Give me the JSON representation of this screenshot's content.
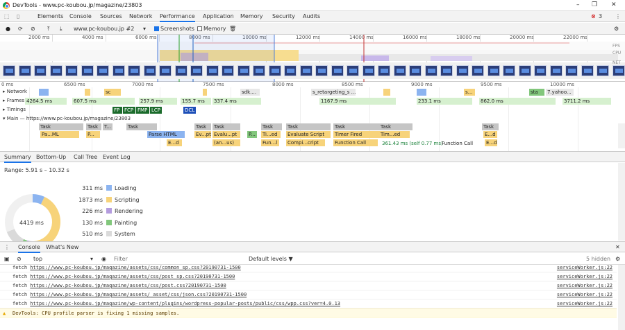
{
  "window": {
    "title": "DevTools - www.pc-koubou.jp/magazine/23803"
  },
  "tabs": [
    "Elements",
    "Console",
    "Sources",
    "Network",
    "Performance",
    "Application",
    "Memory",
    "Security",
    "Audits"
  ],
  "active_tab": "Performance",
  "error_count": "3",
  "toolbar": {
    "recording_select": "www.pc-koubou.jp #2",
    "screenshots_label": "Screenshots",
    "memory_label": "Memory"
  },
  "overview": {
    "ruler": [
      "2000 ms",
      "4000 ms",
      "6000 ms",
      "8000 ms",
      "10000 ms",
      "12000 ms",
      "14000 ms",
      "16000 ms",
      "18000 ms",
      "20000 ms",
      "22000 ms"
    ],
    "fps_label": "FPS",
    "cpu_label": "CPU",
    "net_label": "NET"
  },
  "timeline": {
    "ruler": [
      "0 ms",
      "6500 ms",
      "7000 ms",
      "7500 ms",
      "8000 ms",
      "8500 ms",
      "9000 ms",
      "9500 ms",
      "10000 ms"
    ],
    "network_label": "Network",
    "network_items": [
      "sc",
      "sdk....",
      "s_retargeting_s ...",
      "s...",
      "7.yahoo...",
      "sta"
    ],
    "frames_label": "Frames",
    "frames": [
      "4264.5 ms",
      "607.5 ms",
      "257.9 ms",
      "155.7 ms",
      "337.4 ms",
      "1167.9 ms",
      "233.1 ms",
      "862.0 ms",
      "3711.2 ms"
    ],
    "timings_label": "Timings",
    "timing_markers": [
      "FP",
      "FCP",
      "FMP",
      "LCP",
      "DCL"
    ],
    "main_label": "Main — https://www.pc-koubou.jp/magazine/23803",
    "tasks": [
      "Task",
      "Task",
      "T...",
      "Task",
      "Task",
      "Task",
      "Task",
      "Task",
      "Task",
      "Task",
      "Task"
    ],
    "level2": [
      "Pa...ML",
      "P...",
      "Parse HTML",
      "Ev...pt",
      "Evalu...pt",
      "P...",
      "Ti...ed",
      "Evaluate Script",
      "Timer Fired",
      "Tim...ed",
      "E...d"
    ],
    "level3": [
      "E...d",
      "(an...us)",
      "Fun...l",
      "Compi...cript",
      "Function Call",
      "E...d"
    ],
    "tooltip": {
      "time": "361.43 ms (self 0.77 ms)",
      "name": "Function Call"
    }
  },
  "bottom_tabs": [
    "Summary",
    "Bottom-Up",
    "Call Tree",
    "Event Log"
  ],
  "summary": {
    "range": "Range: 5.91 s – 10.32 s",
    "total": "4419 ms",
    "categories": [
      {
        "value": "311 ms",
        "label": "Loading",
        "color": "#8cb4f0",
        "ms": 311
      },
      {
        "value": "1873 ms",
        "label": "Scripting",
        "color": "#f7d37a",
        "ms": 1873
      },
      {
        "value": "226 ms",
        "label": "Rendering",
        "color": "#b49cde",
        "ms": 226
      },
      {
        "value": "130 ms",
        "label": "Painting",
        "color": "#82c77c",
        "ms": 130
      },
      {
        "value": "510 ms",
        "label": "System",
        "color": "#dadada",
        "ms": 510
      }
    ]
  },
  "drawer_tabs": [
    "Console",
    "What's New"
  ],
  "console_toolbar": {
    "context": "top",
    "filter_placeholder": "Filter",
    "levels": "Default levels ▼",
    "hidden": "5 hidden"
  },
  "console_lines": [
    {
      "prefix": "fetch",
      "url": "https://www.pc-koubou.jp/magazine/assets/css/common_sp.css?20190731-1500",
      "source": "serviceWorker.js:22"
    },
    {
      "prefix": "fetch",
      "url": "https://www.pc-koubou.jp/magazine/assets/css/post_sp.css?20190731-1500",
      "source": "serviceWorker.js:22"
    },
    {
      "prefix": "fetch",
      "url": "https://www.pc-koubou.jp/magazine/assets/css/post.css?20190731-1500",
      "source": "serviceWorker.js:22"
    },
    {
      "prefix": "fetch",
      "url": "https://www.pc-koubou.jp/magazine/assets/ asset/css/json.css?20190731-1500",
      "source": "serviceWorker.js:22"
    },
    {
      "prefix": "fetch",
      "url": "https://www.pc-koubou.jp/magazine/wp-content/plugins/wordpress-popular-posts/public/css/wpp.css?ver=4.0.13",
      "source": "serviceWorker.js:22"
    }
  ],
  "warning": "DevTools: CPU profile parser is fixing 1 missing samples."
}
